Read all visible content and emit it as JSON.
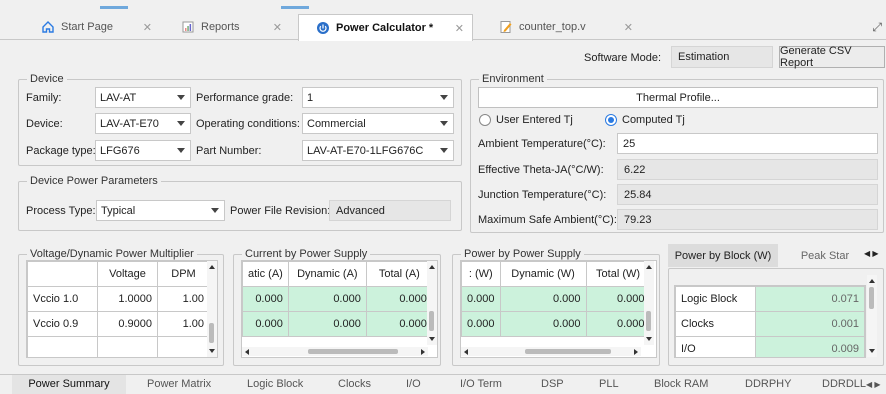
{
  "tabs": [
    {
      "label": "Start Page",
      "icon": "home-icon"
    },
    {
      "label": "Reports",
      "icon": "report-icon"
    },
    {
      "label": "Power Calculator *",
      "icon": "power-calculator-icon"
    },
    {
      "label": "counter_top.v",
      "icon": "verilog-file-icon"
    }
  ],
  "software_mode": {
    "label": "Software Mode:",
    "value": "Estimation"
  },
  "generate_csv": "Generate CSV Report",
  "device": {
    "legend": "Device",
    "family_label": "Family:",
    "family": "LAV-AT",
    "device_label": "Device:",
    "device": "LAV-AT-E70",
    "package_label": "Package type:",
    "package": "LFG676",
    "perf_label": "Performance grade:",
    "perf": "1",
    "cond_label": "Operating conditions:",
    "cond": "Commercial",
    "part_label": "Part Number:",
    "part": "LAV-AT-E70-1LFG676C"
  },
  "dpp": {
    "legend": "Device Power Parameters",
    "process_label": "Process Type:",
    "process": "Typical",
    "pfr_label": "Power File Revision:",
    "pfr": "Advanced"
  },
  "env": {
    "legend": "Environment",
    "thermal_btn": "Thermal Profile...",
    "radio_user": "User Entered Tj",
    "radio_computed": "Computed Tj",
    "ambient_label": "Ambient Temperature(°C):",
    "ambient": "25",
    "theta_label": "Effective Theta-JA(°C/W):",
    "theta": "6.22",
    "junction_label": "Junction Temperature(°C):",
    "junction": "25.84",
    "maxsafe_label": "Maximum Safe Ambient(°C):",
    "maxsafe": "79.23"
  },
  "vdpm": {
    "legend": "Voltage/Dynamic Power Multiplier",
    "headers": [
      "",
      "Voltage",
      "DPM"
    ],
    "rows": [
      [
        "Vccio 1.0",
        "1.0000",
        "1.00"
      ],
      [
        "Vccio 0.9",
        "0.9000",
        "1.00"
      ],
      [
        "",
        "",
        ""
      ]
    ]
  },
  "current": {
    "legend": "Current by Power Supply",
    "headers": [
      "atic (A)",
      "Dynamic (A)",
      "Total (A)"
    ],
    "rows": [
      [
        "0.000",
        "0.000",
        "0.000"
      ],
      [
        "0.000",
        "0.000",
        "0.000"
      ]
    ]
  },
  "power": {
    "legend": "Power by Power Supply",
    "headers": [
      ": (W)",
      "Dynamic (W)",
      "Total (W)"
    ],
    "rows": [
      [
        "0.000",
        "0.000",
        "0.000"
      ],
      [
        "0.000",
        "0.000",
        "0.000"
      ]
    ]
  },
  "block": {
    "tab1": "Power by Block (W)",
    "tab2": "Peak Star",
    "rows": [
      [
        "Logic Block",
        "0.071"
      ],
      [
        "Clocks",
        "0.001"
      ],
      [
        "I/O",
        "0.009"
      ]
    ]
  },
  "bottom_tabs": [
    "Power Summary",
    "Power Matrix",
    "Logic Block",
    "Clocks",
    "I/O",
    "I/O Term",
    "DSP",
    "PLL",
    "Block RAM",
    "DDRPHY",
    "DDRDLL"
  ],
  "colors": {
    "accent": "#2a7ae2",
    "green_cell": "#ccf2dc"
  }
}
